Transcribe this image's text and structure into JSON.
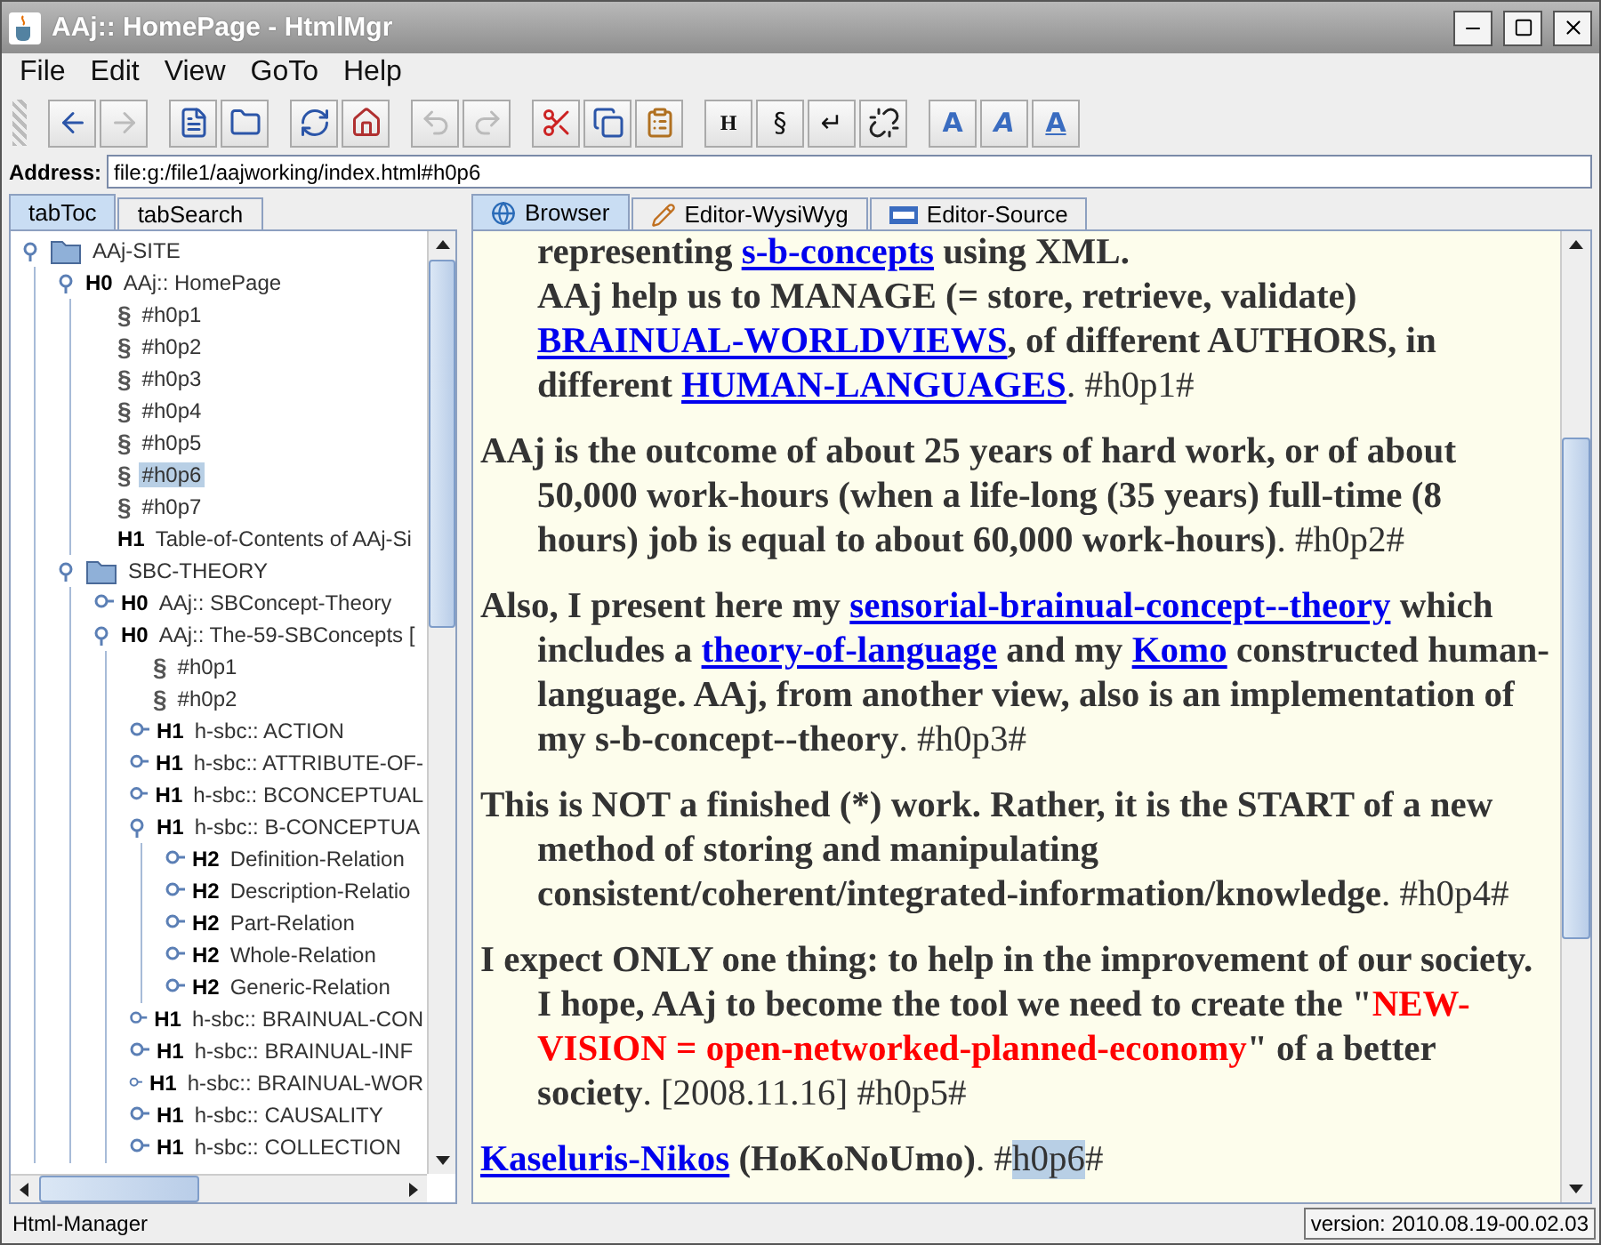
{
  "window": {
    "title": "AAj:: HomePage - HtmlMgr"
  },
  "menu": [
    "File",
    "Edit",
    "View",
    "GoTo",
    "Help"
  ],
  "toolbar": [
    [
      {
        "kind": "icon",
        "disabled": false
      },
      {
        "kind": "icon",
        "disabled": true
      }
    ],
    [
      {
        "kind": "icon",
        "disabled": false
      },
      {
        "kind": "icon",
        "disabled": false
      }
    ],
    [
      {
        "kind": "icon",
        "disabled": false
      },
      {
        "kind": "icon",
        "disabled": false
      }
    ],
    [
      {
        "kind": "icon",
        "disabled": true
      },
      {
        "kind": "icon",
        "disabled": true
      }
    ],
    [
      {
        "kind": "icon",
        "disabled": false
      },
      {
        "kind": "icon",
        "disabled": false
      },
      {
        "kind": "icon",
        "disabled": false
      }
    ],
    [
      {
        "kind": "text",
        "text": "H",
        "disabled": false
      },
      {
        "kind": "text",
        "text": "§",
        "disabled": false
      },
      {
        "kind": "text",
        "text": "↵",
        "disabled": false
      },
      {
        "kind": "icon",
        "disabled": false
      }
    ],
    [
      {
        "kind": "text",
        "text": "A",
        "disabled": false
      },
      {
        "kind": "text",
        "text": "A",
        "disabled": false
      },
      {
        "kind": "text",
        "text": "A",
        "disabled": false
      }
    ]
  ],
  "address": {
    "label": "Address:",
    "value": "file:g:/file1/aajworking/index.html#h0p6"
  },
  "left_tabs": [
    {
      "label": "tabToc",
      "selected": true
    },
    {
      "label": "tabSearch",
      "selected": false
    }
  ],
  "tree": [
    {
      "kind": "folder",
      "text": "AAj-SITE",
      "expanded": true,
      "selected": false,
      "children": [
        {
          "kind": "heading",
          "tag": "H0",
          "text": "AAj:: HomePage",
          "expanded": true,
          "selected": false,
          "children": [
            {
              "kind": "section",
              "tag": "§",
              "text": "#h0p1",
              "selected": false
            },
            {
              "kind": "section",
              "tag": "§",
              "text": "#h0p2",
              "selected": false
            },
            {
              "kind": "section",
              "tag": "§",
              "text": "#h0p3",
              "selected": false
            },
            {
              "kind": "section",
              "tag": "§",
              "text": "#h0p4",
              "selected": false
            },
            {
              "kind": "section",
              "tag": "§",
              "text": "#h0p5",
              "selected": false
            },
            {
              "kind": "section",
              "tag": "§",
              "text": "#h0p6",
              "selected": true
            },
            {
              "kind": "section",
              "tag": "§",
              "text": "#h0p7",
              "selected": false
            },
            {
              "kind": "leaf",
              "tag": "H1",
              "text": "Table-of-Contents of AAj-Si",
              "selected": false
            }
          ]
        },
        {
          "kind": "folder",
          "text": "SBC-THEORY",
          "expanded": true,
          "selected": false,
          "children": [
            {
              "kind": "heading",
              "tag": "H0",
              "text": "AAj:: SBConcept-Theory",
              "expanded": false,
              "selected": false
            },
            {
              "kind": "heading",
              "tag": "H0",
              "text": "AAj:: The-59-SBConcepts [",
              "expanded": true,
              "selected": false,
              "children": [
                {
                  "kind": "section",
                  "tag": "§",
                  "text": "#h0p1",
                  "selected": false
                },
                {
                  "kind": "section",
                  "tag": "§",
                  "text": "#h0p2",
                  "selected": false
                },
                {
                  "kind": "heading",
                  "tag": "H1",
                  "text": "h-sbc:: ACTION",
                  "expanded": false,
                  "selected": false
                },
                {
                  "kind": "heading",
                  "tag": "H1",
                  "text": "h-sbc:: ATTRIBUTE-OF-",
                  "expanded": false,
                  "selected": false
                },
                {
                  "kind": "heading",
                  "tag": "H1",
                  "text": "h-sbc:: BCONCEPTUAL",
                  "expanded": false,
                  "selected": false
                },
                {
                  "kind": "heading",
                  "tag": "H1",
                  "text": "h-sbc:: B-CONCEPTUA",
                  "expanded": true,
                  "selected": false,
                  "children": [
                    {
                      "kind": "heading",
                      "tag": "H2",
                      "text": "Definition-Relation",
                      "expanded": false,
                      "selected": false
                    },
                    {
                      "kind": "heading",
                      "tag": "H2",
                      "text": "Description-Relatio",
                      "expanded": false,
                      "selected": false
                    },
                    {
                      "kind": "heading",
                      "tag": "H2",
                      "text": "Part-Relation",
                      "expanded": false,
                      "selected": false
                    },
                    {
                      "kind": "heading",
                      "tag": "H2",
                      "text": "Whole-Relation",
                      "expanded": false,
                      "selected": false
                    },
                    {
                      "kind": "heading",
                      "tag": "H2",
                      "text": "Generic-Relation",
                      "expanded": false,
                      "selected": false
                    }
                  ]
                },
                {
                  "kind": "heading",
                  "tag": "H1",
                  "text": "h-sbc:: BRAINUAL-CON",
                  "expanded": false,
                  "selected": false
                },
                {
                  "kind": "heading",
                  "tag": "H1",
                  "text": "h-sbc:: BRAINUAL-INF",
                  "expanded": false,
                  "selected": false
                },
                {
                  "kind": "heading",
                  "tag": "H1",
                  "text": "h-sbc:: BRAINUAL-WOR",
                  "expanded": false,
                  "selected": false
                },
                {
                  "kind": "heading",
                  "tag": "H1",
                  "text": "h-sbc:: CAUSALITY",
                  "expanded": false,
                  "selected": false
                },
                {
                  "kind": "heading",
                  "tag": "H1",
                  "text": "h-sbc:: COLLECTION",
                  "expanded": false,
                  "selected": false
                }
              ]
            }
          ]
        }
      ]
    }
  ],
  "right_tabs": [
    {
      "label": "Browser",
      "selected": true
    },
    {
      "label": "Editor-WysiWyg",
      "selected": false
    },
    {
      "label": "Editor-Source",
      "selected": false
    }
  ],
  "paragraphs": [
    {
      "continued": true,
      "segments": [
        {
          "kind": "text",
          "text": "representing "
        },
        {
          "kind": "link",
          "text": "s-b-concepts"
        },
        {
          "kind": "text",
          "text": " using XML."
        },
        {
          "kind": "break"
        },
        {
          "kind": "text",
          "text": "AAj help us to MANAGE (= store, retrieve, validate) "
        },
        {
          "kind": "link",
          "text": "BRAINUAL-WORLDVIEWS"
        },
        {
          "kind": "text",
          "text": ", of different AUTHORS, in different "
        },
        {
          "kind": "link",
          "text": "HUMAN-LANGUAGES"
        },
        {
          "kind": "anchor",
          "text": ". #h0p1#"
        }
      ]
    },
    {
      "continued": false,
      "segments": [
        {
          "kind": "text",
          "text": "AAj is the outcome of about 25 years of hard work, or of about 50,000 work-hours (when a life-long (35 years) full-time (8 hours) job is equal to about 60,000 work-hours)"
        },
        {
          "kind": "anchor",
          "text": ". #h0p2#"
        }
      ]
    },
    {
      "continued": false,
      "segments": [
        {
          "kind": "text",
          "text": "Also, I present here my "
        },
        {
          "kind": "link",
          "text": "sensorial-brainual-concept--theory"
        },
        {
          "kind": "text",
          "text": " which includes a "
        },
        {
          "kind": "link",
          "text": "theory-of-language"
        },
        {
          "kind": "text",
          "text": " and my "
        },
        {
          "kind": "link",
          "text": "Komo"
        },
        {
          "kind": "text",
          "text": " constructed human-language. AAj, from another view, also is an implementation of my s-b-concept--theory"
        },
        {
          "kind": "anchor",
          "text": ". #h0p3#"
        }
      ]
    },
    {
      "continued": false,
      "segments": [
        {
          "kind": "text",
          "text": "This is NOT a finished (*) work. Rather, it is the START of a new method of storing and manipulating consistent/coherent/integrated-information/knowledge"
        },
        {
          "kind": "anchor",
          "text": ". #h0p4#"
        }
      ]
    },
    {
      "continued": false,
      "segments": [
        {
          "kind": "text",
          "text": "I expect ONLY one thing: to help in the improvement of our society. I hope, AAj to become the tool we need to create the \""
        },
        {
          "kind": "red",
          "text": "NEW-VISION = open-networked-planned-economy"
        },
        {
          "kind": "text",
          "text": "\" of a better society"
        },
        {
          "kind": "anchor",
          "text": ". [2008.11.16] #h0p5#"
        }
      ]
    },
    {
      "continued": false,
      "segments": [
        {
          "kind": "link",
          "text": "Kaseluris-Nikos"
        },
        {
          "kind": "text",
          "text": " (HoKoNoUmo)"
        },
        {
          "kind": "anchor",
          "text": ". #"
        },
        {
          "kind": "highlight",
          "text": "h0p6"
        },
        {
          "kind": "anchor",
          "text": "#"
        }
      ]
    }
  ],
  "status_bar": {
    "left": "Html-Manager",
    "right": "version: 2010.08.19-00.02.03"
  }
}
